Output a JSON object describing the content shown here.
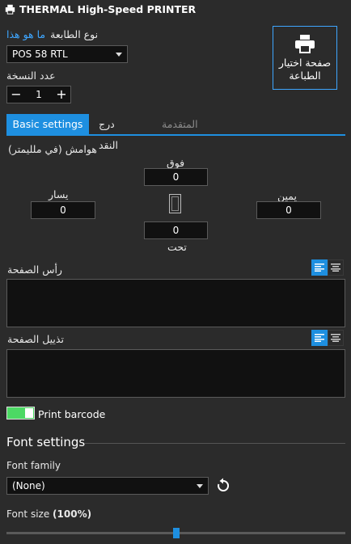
{
  "header": {
    "title": "THERMAL High-Speed PRINTER",
    "icon": "printer-icon"
  },
  "printer_type": {
    "label": "نوع الطابعة",
    "help_link": "ما هو هذا",
    "selected": "POS 58 RTL"
  },
  "copies": {
    "label": "عدد النسخة",
    "value": "1",
    "minus": "−",
    "plus": "+"
  },
  "print_page_button": {
    "label_line1": "صفحة اختيار",
    "label_line2": "الطباعة",
    "icon": "printer-icon"
  },
  "tabs": [
    {
      "label": "Basic settings",
      "active": true
    },
    {
      "label": "درج النقد",
      "active": false
    },
    {
      "label": "المتقدمة",
      "active": false,
      "disabled": true
    }
  ],
  "margins": {
    "label": "هوامش (في ملليمتر)",
    "top": {
      "label": "فوق",
      "value": "0"
    },
    "left": {
      "label": "يسار",
      "value": "0"
    },
    "right": {
      "label": "يمين",
      "value": "0"
    },
    "bottom": {
      "label": "تحت",
      "value": "0"
    }
  },
  "page_header": {
    "label": "رأس الصفحة",
    "value": ""
  },
  "page_footer": {
    "label": "تذييل الصفحة",
    "value": ""
  },
  "print_barcode": {
    "label": "Print barcode",
    "enabled": true
  },
  "font_settings": {
    "heading": "Font settings",
    "family_label": "Font family",
    "family_value": "(None)",
    "size_label_prefix": "Font size ",
    "size_label_value": "(100%)",
    "size_percent": 100,
    "size_slider_fraction": 0.5
  },
  "colors": {
    "accent": "#1e8fe0",
    "link": "#3ea6ff",
    "toggle_on": "#4cd964",
    "background": "#2b2b2b"
  }
}
